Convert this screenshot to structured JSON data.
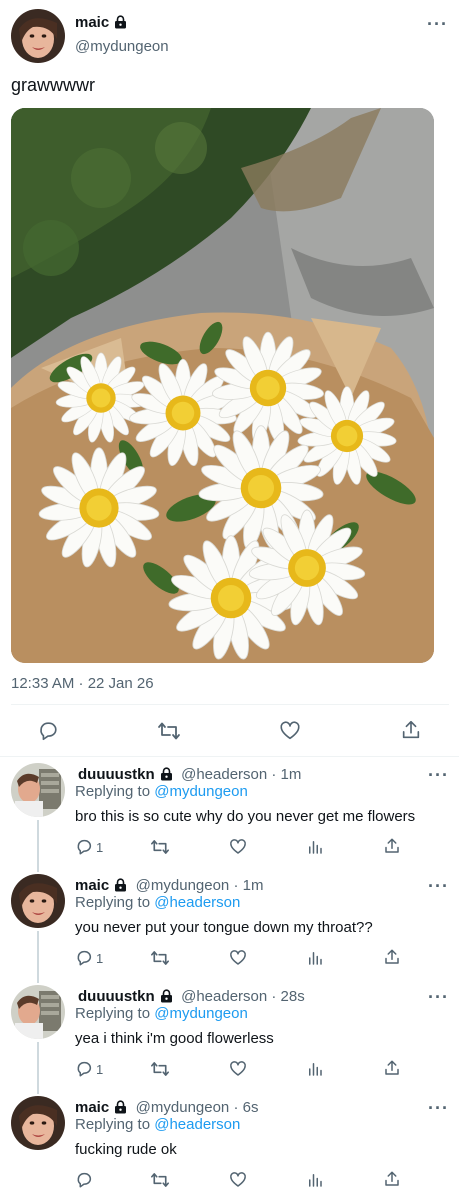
{
  "main_tweet": {
    "author_name": "maic",
    "author_handle": "@mydungeon",
    "text": "grawwwwr",
    "timestamp": "12:33 AM · 22 Jan 26",
    "more": "···"
  },
  "replies": [
    {
      "name": "duuuustkn",
      "handle": "@headerson · 1m",
      "replying_prefix": "Replying to ",
      "replying_to": "@mydungeon",
      "text": "bro this is so cute why do you never get me flowers",
      "reply_count": "1"
    },
    {
      "name": "maic",
      "handle": "@mydungeon · 1m",
      "replying_prefix": "Replying to ",
      "replying_to": "@headerson",
      "text": "you never put your tongue down my throat??",
      "reply_count": "1"
    },
    {
      "name": "duuuustkn",
      "handle": "@headerson · 28s",
      "replying_prefix": "Replying to ",
      "replying_to": "@mydungeon",
      "text": "yea i think i'm good flowerless",
      "reply_count": "1"
    },
    {
      "name": "maic",
      "handle": "@mydungeon · 6s",
      "replying_prefix": "Replying to ",
      "replying_to": "@headerson",
      "text": "fucking rude ok",
      "reply_count": ""
    }
  ],
  "icons": {
    "lock": "lock-icon",
    "reply": "reply-icon",
    "retweet": "retweet-icon",
    "like": "heart-icon",
    "views": "analytics-icon",
    "share": "share-icon"
  },
  "colors": {
    "link": "#1d9bf0",
    "secondary_text": "#536471",
    "divider": "#eff3f4",
    "thread_line": "#cfd9de"
  }
}
